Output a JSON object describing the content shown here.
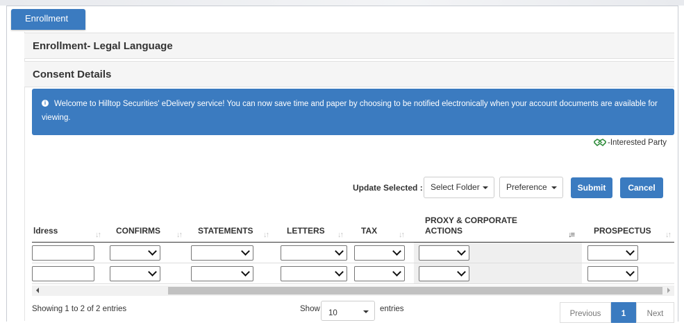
{
  "tab": {
    "label": "Enrollment"
  },
  "section_title": "Enrollment- Legal Language",
  "subsection_title": "Consent Details",
  "alert": {
    "icon": "info-icon",
    "message": "Welcome to Hilltop Securities' eDelivery service! You can now save time and paper by choosing to be notified electronically when your account documents are available for viewing."
  },
  "legend": {
    "icon": "handshake-icon",
    "icon_color": "#2e8b3a",
    "label": "-Interested Party"
  },
  "update": {
    "label": "Update Selected :",
    "folder_select": "Select Folder",
    "preference_select": "Preference",
    "submit_label": "Submit",
    "cancel_label": "Cancel"
  },
  "table": {
    "columns": [
      "ldress",
      "CONFIRMS",
      "STATEMENTS",
      "LETTERS",
      "TAX",
      "PROXY & CORPORATE ACTIONS",
      "PROSPECTUS"
    ],
    "sorted_column": "PROXY & CORPORATE ACTIONS",
    "rows": [
      {
        "address": "",
        "confirms": "",
        "statements": "",
        "letters": "",
        "tax": "",
        "proxy": "",
        "prospectus": ""
      },
      {
        "address": "",
        "confirms": "",
        "statements": "",
        "letters": "",
        "tax": "",
        "proxy": "",
        "prospectus": ""
      }
    ]
  },
  "footer": {
    "info": "Showing 1 to 2 of 2 entries",
    "show_label": "Show",
    "page_length": "10",
    "entries_label": "entries",
    "previous": "Previous",
    "current_page": "1",
    "next": "Next"
  },
  "colors": {
    "accent": "#3b7bc0",
    "header_bg": "#f5f5f5"
  }
}
